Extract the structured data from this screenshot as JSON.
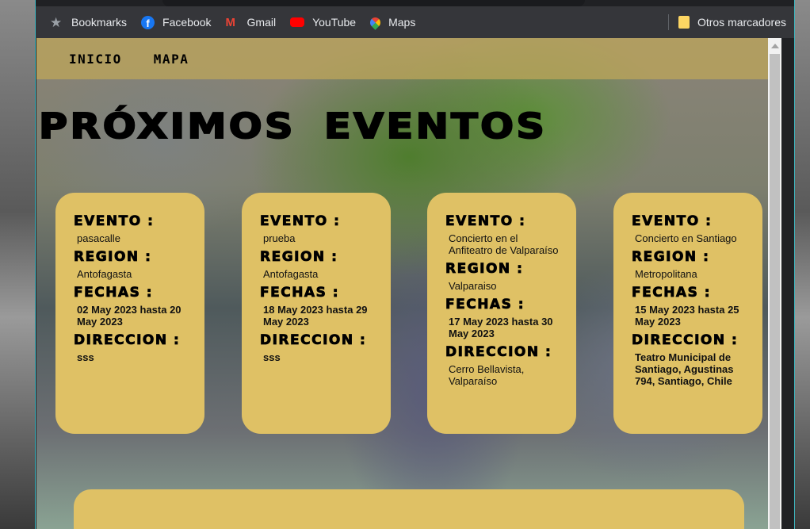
{
  "bookmarks": [
    {
      "label": "Bookmarks",
      "icon": "star-icon",
      "color": "#9aa0a6"
    },
    {
      "label": "Facebook",
      "icon": "facebook-icon",
      "color": "#1877f2"
    },
    {
      "label": "Gmail",
      "icon": "gmail-icon",
      "color": "#ea4335"
    },
    {
      "label": "YouTube",
      "icon": "youtube-icon",
      "color": "#ff0000"
    },
    {
      "label": "Maps",
      "icon": "maps-icon",
      "color": "#34a853"
    }
  ],
  "other_bookmarks": "Otros marcadores",
  "nav": {
    "inicio": "INICIO",
    "mapa": "MAPA"
  },
  "title": "PRÓXIMOS EVENTOS",
  "labels": {
    "evento": "EVENTO :",
    "region": "REGION :",
    "fechas": "FECHAS :",
    "direccion": "DIRECCION :"
  },
  "events": [
    {
      "evento": "pasacalle",
      "region": "Antofagasta",
      "fechas": "02 May 2023 hasta 20 May 2023",
      "direccion": "sss"
    },
    {
      "evento": "prueba",
      "region": "Antofagasta",
      "fechas": "18 May 2023 hasta 29 May 2023",
      "direccion": "sss"
    },
    {
      "evento": "Concierto en el Anfiteatro de Valparaíso",
      "region": "Valparaiso",
      "fechas": "17 May 2023 hasta 30 May 2023",
      "direccion": "Cerro Bellavista, Valparaíso"
    },
    {
      "evento": "Concierto en Santiago",
      "region": "Metropolitana",
      "fechas": "15 May 2023 hasta 25 May 2023",
      "direccion": "Teatro Municipal de Santiago, Agustinas 794, Santiago, Chile"
    }
  ],
  "colors": {
    "card": "#dfc165",
    "nav": "#bea55a"
  }
}
